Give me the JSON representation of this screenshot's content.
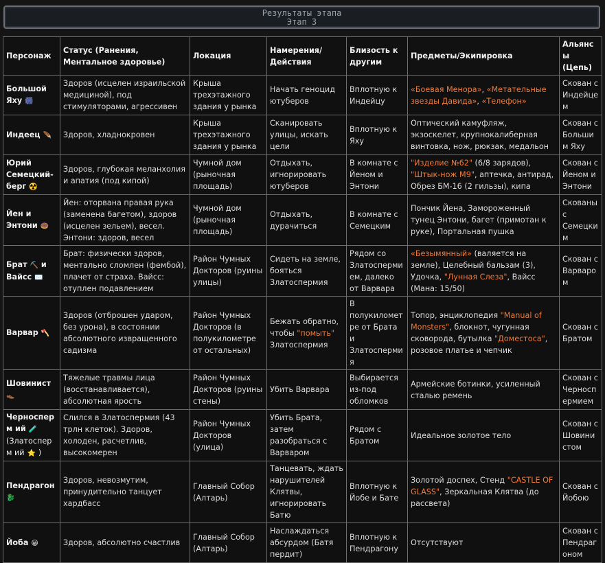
{
  "banner": {
    "line1": "Результаты этапа",
    "line2": "Этап 3"
  },
  "table": {
    "headers": [
      "Персонаж",
      "Статус (Ранения, Ментальное здоровье)",
      "Локация",
      "Намерения/Действия",
      "Близость к другим",
      "Предметы/Экипировка",
      "Альянсы (Цепь)"
    ],
    "rows": [
      {
        "name": "Большой Яху",
        "name_icon": "🎆",
        "status": "Здоров (исцелен израильской медициной), под стимуляторами, агрессивен",
        "location": "Крыша трехэтажного здания у рынка",
        "intent": [
          {
            "t": "Начать геноцид ютуберов"
          }
        ],
        "proximity": "Вплотную к Индейцу",
        "items": [
          {
            "t": "«Боевая Менора»",
            "hl": true
          },
          {
            "t": ", "
          },
          {
            "t": "«Метательные звезды Давида»",
            "hl": true
          },
          {
            "t": ", "
          },
          {
            "t": "«Телефон»",
            "hl": true
          }
        ],
        "alliance": "Скован с Индейцем"
      },
      {
        "name": "Индеец",
        "name_icon": "🪶",
        "status": "Здоров, хладнокровен",
        "location": "Крыша трехэтажного здания у рынка",
        "intent": [
          {
            "t": "Сканировать улицы, искать цели"
          }
        ],
        "proximity": "Вплотную к Яху",
        "items": [
          {
            "t": "Оптический камуфляж, экзоскелет, крупнокалиберная винтовка, нож, рюкзак, медальон"
          }
        ],
        "alliance": "Скован с Большим Яху"
      },
      {
        "name": "Юрий Семецкий-берг",
        "name_icon": "☢️",
        "status": "Здоров, глубокая меланхолия и апатия (под кипой)",
        "location": "Чумной дом (рыночная площадь)",
        "intent": [
          {
            "t": "Отдыхать, игнорировать ютуберов"
          }
        ],
        "proximity": "В комнате с Йеном и Энтони",
        "items": [
          {
            "t": "\"Изделие №62\"",
            "hl": true
          },
          {
            "t": " (6/8 зарядов), "
          },
          {
            "t": "\"Штык-нож М9\"",
            "hl": true
          },
          {
            "t": ", аптечка, антирад, Обрез БМ-16 (2 гильзы), кипа"
          }
        ],
        "alliance": "Скован с Йеном и Энтони"
      },
      {
        "name": "Йен и Энтони",
        "name_icon": "🍩",
        "status": "Йен: оторвана правая рука (заменена багетом), здоров (исцелен зельем), весел. Энтони: здоров, весел",
        "location": "Чумной дом (рыночная площадь)",
        "intent": [
          {
            "t": "Отдыхать, дурачиться"
          }
        ],
        "proximity": "В комнате с Семецким",
        "items": [
          {
            "t": "Пончик Йена, Замороженный тунец Энтони, багет (примотан к руке), Портальная пушка"
          }
        ],
        "alliance": "Скованы с Семецким"
      },
      {
        "name": "Брат",
        "name_icon": "⛏️",
        "name2": "Вайсс",
        "name2_icon": "✉️",
        "status": "Брат: физически здоров, ментально сломлен (фембой), плачет от страха. Вайсс: отуплен подавлением",
        "location": "Район Чумных Докторов (руины улицы)",
        "intent": [
          {
            "t": "Сидеть на земле, бояться Златоспермия"
          }
        ],
        "proximity": "Рядом со Златоспермием, далеко от Варвара",
        "items": [
          {
            "t": "«Безымянный»",
            "hl": true
          },
          {
            "t": " (валяется на земле), Целебный бальзам (3), Удочка, "
          },
          {
            "t": "\"Лунная Слеза\"",
            "hl": true
          },
          {
            "t": ", Вайсс (Мана: 15/50)"
          }
        ],
        "alliance": "Скован с Варваром"
      },
      {
        "name": "Варвар",
        "name_icon": "🪓",
        "status": "Здоров (отброшен ударом, без урона), в состоянии абсолютного извращенного садизма",
        "location": "Район Чумных Докторов (в полукилометре от остальных)",
        "intent": [
          {
            "t": "Бежать обратно, чтобы "
          },
          {
            "t": "\"помыть\"",
            "hl": true
          },
          {
            "t": " Златоспермия"
          }
        ],
        "proximity": "В полукилометре от Брата и Златоспермия",
        "items": [
          {
            "t": "Топор, энциклопедия "
          },
          {
            "t": "\"Manual of Monsters\"",
            "hl": true
          },
          {
            "t": ", блокнот, чугунная сковорода, бутылка "
          },
          {
            "t": "\"Доместоса\"",
            "hl": true
          },
          {
            "t": ", розовое платье и чепчик"
          }
        ],
        "alliance": "Скован с Братом"
      },
      {
        "name": "Шовинист",
        "name_icon": "👞",
        "status": "Тяжелые травмы лица (восстанавливается), абсолютная ярость",
        "location": "Район Чумных Докторов (руины стены)",
        "intent": [
          {
            "t": "Убить Варвара"
          }
        ],
        "proximity": "Выбирается из-под обломков",
        "items": [
          {
            "t": "Армейские ботинки, усиленный сталью ремень"
          }
        ],
        "alliance": "Скован с Черноспермием"
      },
      {
        "name": "Черносперм ий",
        "name_icon": "🧪",
        "name_sub": "(Златосперм ий",
        "name_sub_icon": "⭐",
        "name_sub_close": ")",
        "status": "Слился в Златоспермия (43 трлн клеток). Здоров, холоден, расчетлив, высокомерен",
        "location": "Район Чумных Докторов (улица)",
        "intent": [
          {
            "t": "Убить Брата, затем разобраться с Варваром"
          }
        ],
        "proximity": "Рядом с Братом",
        "items": [
          {
            "t": "Идеальное золотое тело"
          }
        ],
        "alliance": "Скован с Шовинистом"
      },
      {
        "name": "Пендрагон",
        "name_icon": "🐉",
        "status": "Здоров, невозмутим, принудительно танцует хардбасс",
        "location": "Главный Собор (Алтарь)",
        "intent": [
          {
            "t": "Танцевать, ждать нарушителей Клятвы, игнорировать Батю"
          }
        ],
        "proximity": "Вплотную к Йобе и Бате",
        "items": [
          {
            "t": "Золотой доспех, Стенд "
          },
          {
            "t": "\"CASTLE OF GLASS\"",
            "hl": true
          },
          {
            "t": ", Зеркальная Клятва (до рассвета)"
          }
        ],
        "alliance": "Скован с Йобою"
      },
      {
        "name": "Йоба",
        "name_icon": "😀",
        "status": "Здоров, абсолютно счастлив",
        "location": "Главный Собор (Алтарь)",
        "intent": [
          {
            "t": "Наслаждаться абсурдом (Батя пердит)"
          }
        ],
        "proximity": "Вплотную к Пендрагону",
        "items": [
          {
            "t": "Отсутствуют"
          }
        ],
        "alliance": "Скован с Пендрагоном"
      }
    ]
  }
}
